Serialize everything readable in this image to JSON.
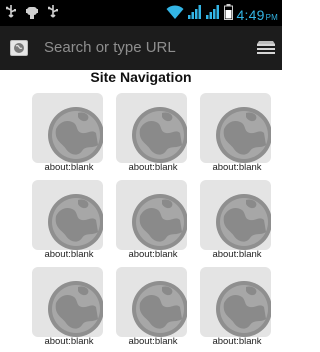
{
  "status_bar": {
    "time": "4:49",
    "ampm": "PM",
    "icons": [
      "usb-icon",
      "android-debug-icon",
      "usb-icon",
      "wifi-icon",
      "signal-icon",
      "signal-icon",
      "battery-icon"
    ],
    "accent_color": "#33b5e5"
  },
  "toolbar": {
    "search_placeholder": "Search or type URL",
    "url_icon": "globe-page-icon",
    "menu_icon": "bookmarks-menu-icon"
  },
  "page": {
    "heading": "Site Navigation"
  },
  "tiles": [
    {
      "label": "about:blank"
    },
    {
      "label": "about:blank"
    },
    {
      "label": "about:blank"
    },
    {
      "label": "about:blank"
    },
    {
      "label": "about:blank"
    },
    {
      "label": "about:blank"
    },
    {
      "label": "about:blank"
    },
    {
      "label": "about:blank"
    },
    {
      "label": "about:blank"
    }
  ]
}
